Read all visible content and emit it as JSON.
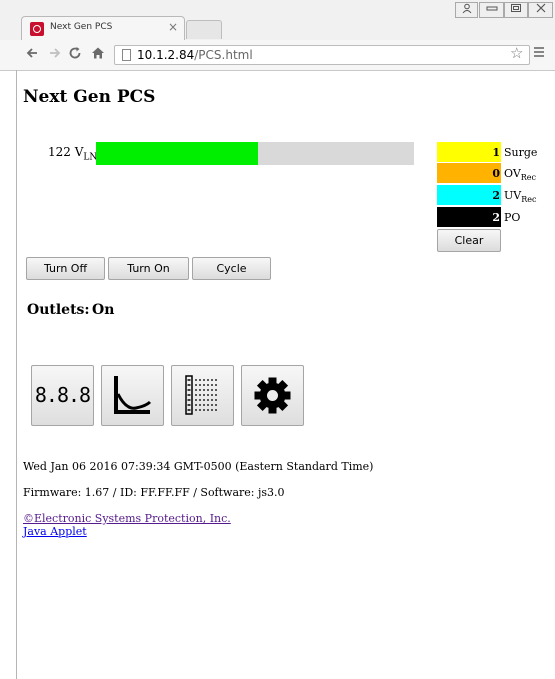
{
  "browser": {
    "tab_title": "Next Gen PCS",
    "tab_close": "×",
    "url_host": "10.1.2.84",
    "url_path": "/PCS.html",
    "window_controls": [
      "user-icon",
      "minimize-icon",
      "maximize-icon",
      "close-icon"
    ],
    "nav_icons": [
      "back-arrow-icon",
      "forward-arrow-icon",
      "reload-icon",
      "home-icon",
      "star-icon",
      "menu-icon"
    ]
  },
  "page": {
    "title": "Next Gen PCS",
    "voltage": {
      "value": "122 V",
      "sub": "LN",
      "level_fraction": 0.51,
      "bar_color": "#00ee00",
      "track_color": "#d9d9d9"
    },
    "events": [
      {
        "count": "1",
        "label": "Surge",
        "sub": "",
        "color": "#ffff00",
        "text_color": "#000000"
      },
      {
        "count": "0",
        "label": "OV",
        "sub": "Rec",
        "color": "#ffb300",
        "text_color": "#000000"
      },
      {
        "count": "2",
        "label": "UV",
        "sub": "Rec",
        "color": "#00ffff",
        "text_color": "#000000"
      },
      {
        "count": "2",
        "label": "PO",
        "sub": "",
        "color": "#000000",
        "text_color": "#ffffff"
      }
    ],
    "clear_label": "Clear",
    "buttons": {
      "turn_off": "Turn Off",
      "turn_on": "Turn On",
      "cycle": "Cycle"
    },
    "outlets": {
      "label": "Outlets:",
      "state": "On"
    },
    "icon_buttons": {
      "meter_text": "8.8.8",
      "icons": [
        "meter-icon",
        "graph-icon",
        "log-icon",
        "gear-icon"
      ]
    },
    "datetime": "Wed Jan 06 2016 07:39:34 GMT-0500 (Eastern Standard Time)",
    "firmware": "Firmware: 1.67 / ID: FF.FF.FF / Software: js3.0",
    "links": {
      "company": "©Electronic Systems Protection, Inc.",
      "applet": "Java Applet"
    }
  }
}
